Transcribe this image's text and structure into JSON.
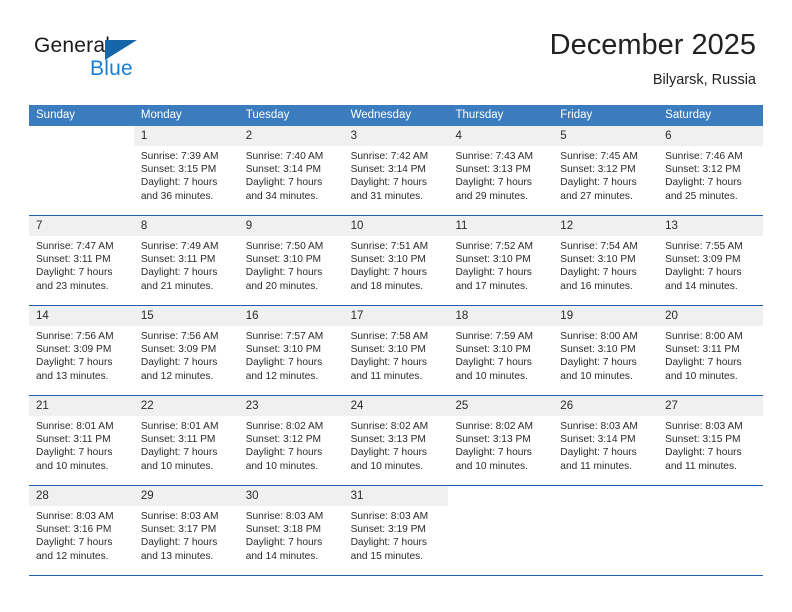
{
  "brand": {
    "name_part1": "General",
    "name_part2": "Blue",
    "accent_color": "#1a7fd4",
    "triangle_color": "#1565a8"
  },
  "header": {
    "month_year": "December 2025",
    "location": "Bilyarsk, Russia"
  },
  "calendar": {
    "header_bg": "#3a7cbe",
    "grid_line_color": "#1f5fa6",
    "day_number_bg": "#f0f0f0",
    "weekdays": [
      "Sunday",
      "Monday",
      "Tuesday",
      "Wednesday",
      "Thursday",
      "Friday",
      "Saturday"
    ],
    "weeks": [
      [
        {
          "day": "",
          "lines": []
        },
        {
          "day": "1",
          "lines": [
            "Sunrise: 7:39 AM",
            "Sunset: 3:15 PM",
            "Daylight: 7 hours",
            "and 36 minutes."
          ]
        },
        {
          "day": "2",
          "lines": [
            "Sunrise: 7:40 AM",
            "Sunset: 3:14 PM",
            "Daylight: 7 hours",
            "and 34 minutes."
          ]
        },
        {
          "day": "3",
          "lines": [
            "Sunrise: 7:42 AM",
            "Sunset: 3:14 PM",
            "Daylight: 7 hours",
            "and 31 minutes."
          ]
        },
        {
          "day": "4",
          "lines": [
            "Sunrise: 7:43 AM",
            "Sunset: 3:13 PM",
            "Daylight: 7 hours",
            "and 29 minutes."
          ]
        },
        {
          "day": "5",
          "lines": [
            "Sunrise: 7:45 AM",
            "Sunset: 3:12 PM",
            "Daylight: 7 hours",
            "and 27 minutes."
          ]
        },
        {
          "day": "6",
          "lines": [
            "Sunrise: 7:46 AM",
            "Sunset: 3:12 PM",
            "Daylight: 7 hours",
            "and 25 minutes."
          ]
        }
      ],
      [
        {
          "day": "7",
          "lines": [
            "Sunrise: 7:47 AM",
            "Sunset: 3:11 PM",
            "Daylight: 7 hours",
            "and 23 minutes."
          ]
        },
        {
          "day": "8",
          "lines": [
            "Sunrise: 7:49 AM",
            "Sunset: 3:11 PM",
            "Daylight: 7 hours",
            "and 21 minutes."
          ]
        },
        {
          "day": "9",
          "lines": [
            "Sunrise: 7:50 AM",
            "Sunset: 3:10 PM",
            "Daylight: 7 hours",
            "and 20 minutes."
          ]
        },
        {
          "day": "10",
          "lines": [
            "Sunrise: 7:51 AM",
            "Sunset: 3:10 PM",
            "Daylight: 7 hours",
            "and 18 minutes."
          ]
        },
        {
          "day": "11",
          "lines": [
            "Sunrise: 7:52 AM",
            "Sunset: 3:10 PM",
            "Daylight: 7 hours",
            "and 17 minutes."
          ]
        },
        {
          "day": "12",
          "lines": [
            "Sunrise: 7:54 AM",
            "Sunset: 3:10 PM",
            "Daylight: 7 hours",
            "and 16 minutes."
          ]
        },
        {
          "day": "13",
          "lines": [
            "Sunrise: 7:55 AM",
            "Sunset: 3:09 PM",
            "Daylight: 7 hours",
            "and 14 minutes."
          ]
        }
      ],
      [
        {
          "day": "14",
          "lines": [
            "Sunrise: 7:56 AM",
            "Sunset: 3:09 PM",
            "Daylight: 7 hours",
            "and 13 minutes."
          ]
        },
        {
          "day": "15",
          "lines": [
            "Sunrise: 7:56 AM",
            "Sunset: 3:09 PM",
            "Daylight: 7 hours",
            "and 12 minutes."
          ]
        },
        {
          "day": "16",
          "lines": [
            "Sunrise: 7:57 AM",
            "Sunset: 3:10 PM",
            "Daylight: 7 hours",
            "and 12 minutes."
          ]
        },
        {
          "day": "17",
          "lines": [
            "Sunrise: 7:58 AM",
            "Sunset: 3:10 PM",
            "Daylight: 7 hours",
            "and 11 minutes."
          ]
        },
        {
          "day": "18",
          "lines": [
            "Sunrise: 7:59 AM",
            "Sunset: 3:10 PM",
            "Daylight: 7 hours",
            "and 10 minutes."
          ]
        },
        {
          "day": "19",
          "lines": [
            "Sunrise: 8:00 AM",
            "Sunset: 3:10 PM",
            "Daylight: 7 hours",
            "and 10 minutes."
          ]
        },
        {
          "day": "20",
          "lines": [
            "Sunrise: 8:00 AM",
            "Sunset: 3:11 PM",
            "Daylight: 7 hours",
            "and 10 minutes."
          ]
        }
      ],
      [
        {
          "day": "21",
          "lines": [
            "Sunrise: 8:01 AM",
            "Sunset: 3:11 PM",
            "Daylight: 7 hours",
            "and 10 minutes."
          ]
        },
        {
          "day": "22",
          "lines": [
            "Sunrise: 8:01 AM",
            "Sunset: 3:11 PM",
            "Daylight: 7 hours",
            "and 10 minutes."
          ]
        },
        {
          "day": "23",
          "lines": [
            "Sunrise: 8:02 AM",
            "Sunset: 3:12 PM",
            "Daylight: 7 hours",
            "and 10 minutes."
          ]
        },
        {
          "day": "24",
          "lines": [
            "Sunrise: 8:02 AM",
            "Sunset: 3:13 PM",
            "Daylight: 7 hours",
            "and 10 minutes."
          ]
        },
        {
          "day": "25",
          "lines": [
            "Sunrise: 8:02 AM",
            "Sunset: 3:13 PM",
            "Daylight: 7 hours",
            "and 10 minutes."
          ]
        },
        {
          "day": "26",
          "lines": [
            "Sunrise: 8:03 AM",
            "Sunset: 3:14 PM",
            "Daylight: 7 hours",
            "and 11 minutes."
          ]
        },
        {
          "day": "27",
          "lines": [
            "Sunrise: 8:03 AM",
            "Sunset: 3:15 PM",
            "Daylight: 7 hours",
            "and 11 minutes."
          ]
        }
      ],
      [
        {
          "day": "28",
          "lines": [
            "Sunrise: 8:03 AM",
            "Sunset: 3:16 PM",
            "Daylight: 7 hours",
            "and 12 minutes."
          ]
        },
        {
          "day": "29",
          "lines": [
            "Sunrise: 8:03 AM",
            "Sunset: 3:17 PM",
            "Daylight: 7 hours",
            "and 13 minutes."
          ]
        },
        {
          "day": "30",
          "lines": [
            "Sunrise: 8:03 AM",
            "Sunset: 3:18 PM",
            "Daylight: 7 hours",
            "and 14 minutes."
          ]
        },
        {
          "day": "31",
          "lines": [
            "Sunrise: 8:03 AM",
            "Sunset: 3:19 PM",
            "Daylight: 7 hours",
            "and 15 minutes."
          ]
        },
        {
          "day": "",
          "lines": []
        },
        {
          "day": "",
          "lines": []
        },
        {
          "day": "",
          "lines": []
        }
      ]
    ]
  }
}
